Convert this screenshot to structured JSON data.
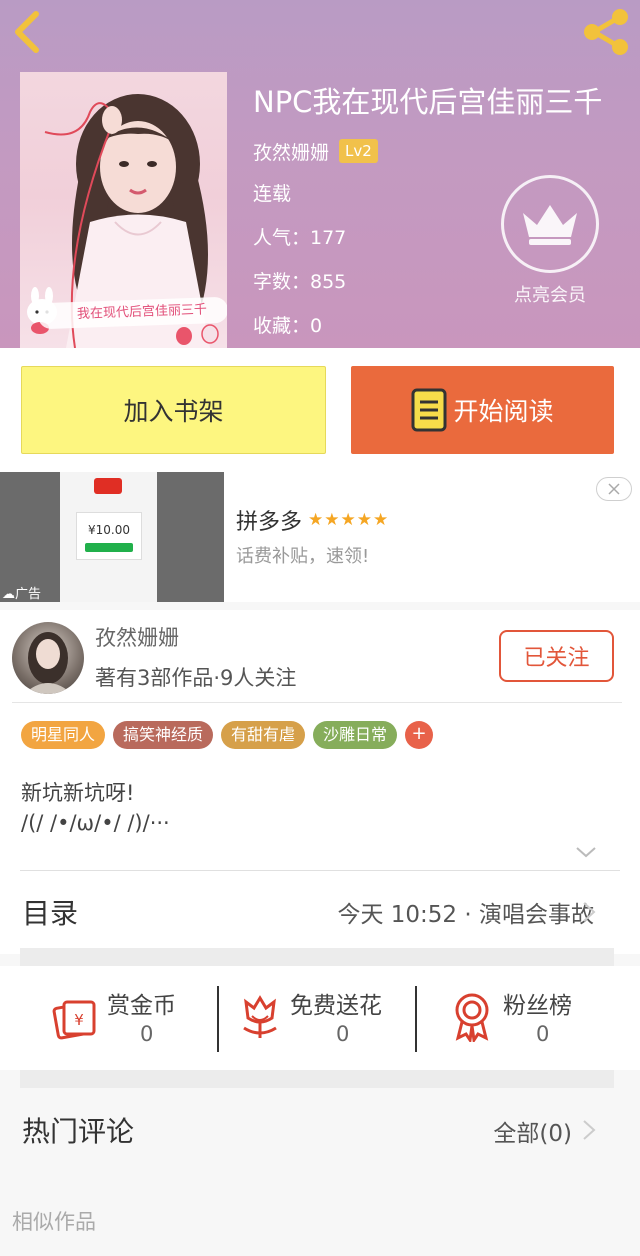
{
  "book": {
    "title": "NPC我在现代后宫佳丽三千",
    "cover_caption": "我在现代后宫佳丽三千",
    "author": "孜然姗姗",
    "author_level": "Lv2",
    "status": "连载",
    "popularity": "人气：177",
    "word_count": "字数：855",
    "favorites": "收藏：0"
  },
  "vip": {
    "label": "点亮会员"
  },
  "actions": {
    "add_shelf": "加入书架",
    "start_reading": "开始阅读"
  },
  "ad": {
    "title": "拼多多",
    "stars": "★★★★★",
    "subtitle": "话费补贴，速领!",
    "tag": "广告",
    "screen_price": "¥10.00"
  },
  "author_card": {
    "name": "孜然姗姗",
    "stats": "著有3部作品·9人关注",
    "follow_label": "已关注"
  },
  "tags": [
    {
      "label": "明星同人",
      "color": "#f2a541"
    },
    {
      "label": "搞笑神经质",
      "color": "#b96a5c"
    },
    {
      "label": "有甜有虐",
      "color": "#d6a04a"
    },
    {
      "label": "沙雕日常",
      "color": "#86ad5b"
    }
  ],
  "tag_more": "+",
  "intro": {
    "line1": "新坑新坑呀!",
    "line2": "/(/ /•/ω/•/ /)/···"
  },
  "catalog": {
    "title": "目录",
    "latest": "今天 10:52 · 演唱会事故"
  },
  "rewards": [
    {
      "label": "赏金币",
      "count": "0",
      "icon": "red-envelope-icon"
    },
    {
      "label": "免费送花",
      "count": "0",
      "icon": "flower-icon"
    },
    {
      "label": "粉丝榜",
      "count": "0",
      "icon": "medal-icon"
    }
  ],
  "comments": {
    "title": "热门评论",
    "all_label": "全部(0)"
  },
  "similar": {
    "title": "相似作品"
  },
  "colors": {
    "accent": "#ea6a3d",
    "shelf": "#fdf680",
    "follow": "#e2563a"
  }
}
